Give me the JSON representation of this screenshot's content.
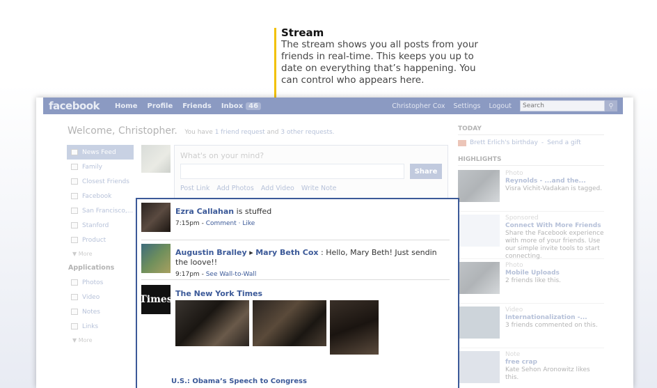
{
  "callout": {
    "title": "Stream",
    "body": "The stream shows you all posts from your friends in real-time. This keeps you up to date on everything that’s happening.  You can control who appears here."
  },
  "topbar": {
    "logo": "facebook",
    "nav": [
      "Home",
      "Profile",
      "Friends",
      "Inbox"
    ],
    "inbox_count": "46",
    "user_name": "Christopher Cox",
    "settings": "Settings",
    "logout": "Logout",
    "search_placeholder": "Search"
  },
  "welcome": {
    "title": "Welcome, Christopher.",
    "you_have": "You have",
    "friend_request": "1 friend request",
    "and": "and",
    "other_requests": "3 other requests."
  },
  "left_nav": {
    "items": [
      "News Feed",
      "Family",
      "Closest Friends",
      "Facebook",
      "San Francisco,...",
      "Stanford",
      "Product"
    ],
    "more_1": "▼ More",
    "applications_heading": "Applications",
    "apps": [
      "Photos",
      "Video",
      "Notes",
      "Links"
    ],
    "more_2": "▼ More"
  },
  "composer": {
    "prompt": "What's on your mind?",
    "share": "Share",
    "actions": [
      "Post Link",
      "Add Photos",
      "Add Video",
      "Write Note"
    ]
  },
  "right_col": {
    "today_heading": "TODAY",
    "birthday": "Brett Erlich's birthday",
    "send_gift": "Send a gift",
    "highlights_heading": "HIGHLIGHTS",
    "highlights": [
      {
        "category": "Photo",
        "title": "Reynolds - ...and the...",
        "text": "Visra Vichit-Vadakan is tagged."
      },
      {
        "category": "Sponsored",
        "title": "Connect With More Friends",
        "text": "Share the Facebook experience with more of your friends. Use our simple invite tools to start connecting."
      },
      {
        "category": "Photo",
        "title": "Mobile Uploads",
        "text": "2 friends like this."
      },
      {
        "category": "Video",
        "title": "Internationalization -...",
        "text": "3 friends commented on this."
      },
      {
        "category": "Note",
        "title": "free crap",
        "text": "Kate Sehon Aronowitz likes this."
      }
    ]
  },
  "stream": {
    "stories": [
      {
        "actor": "Ezra Callahan",
        "text": " is stuffed",
        "time": "7:15pm",
        "links": "Comment · Like"
      },
      {
        "actor": "Augustin Bralley",
        "arrow": " ▸ ",
        "target": "Mary Beth Cox",
        "text": " : Hello, Mary Beth! Just sendin the loove!!",
        "time": "9:17pm",
        "links": "See Wall-to-Wall"
      },
      {
        "actor": "The New York Times",
        "avatar_text": "Times",
        "headline": "U.S.: Obama’s Speech to Congress"
      }
    ]
  },
  "colors": {
    "topbar": "#8b9ac2",
    "link": "#3b5998",
    "callout_accent": "#f2c100",
    "stream_border": "#3b5998"
  }
}
